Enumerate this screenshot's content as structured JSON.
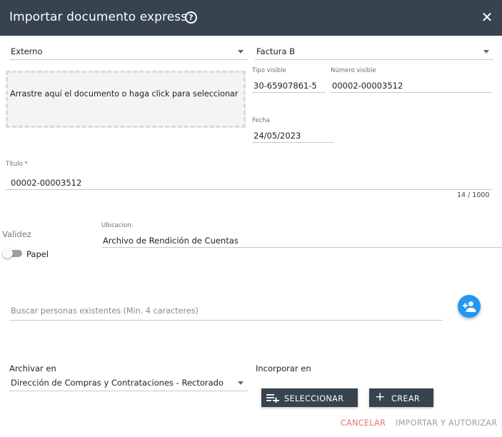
{
  "dialog": {
    "title": "Importar documento express",
    "help_icon": "help-circle-icon",
    "close_icon": "close-icon",
    "help_glyph": "?",
    "close_glyph": "✕"
  },
  "colors": {
    "header": "#37434e",
    "accent": "#2196f3",
    "cancel": "#e57373",
    "disabled": "#9e9e9e"
  },
  "origin_select": {
    "value": "Externo"
  },
  "doc_type_select": {
    "value": "Factura B"
  },
  "dropzone": {
    "text": "Arrastre aquí el documento o haga click para seleccionar"
  },
  "tipo_visible": {
    "label": "Tipo visible",
    "value": "30-65907861-5"
  },
  "numero_visible": {
    "label": "Número visible",
    "value": "00002-00003512"
  },
  "fecha": {
    "label": "Fecha",
    "value": "24/05/2023"
  },
  "titulo": {
    "label": "Título *",
    "value": "00002-00003512",
    "counter": "14 / 1000"
  },
  "validez": {
    "label": "Validez",
    "toggle_label": "Papel",
    "toggle_on": false
  },
  "ubicacion": {
    "label": "Ubicacion:",
    "value": "Archivo de Rendición de Cuentas"
  },
  "search": {
    "placeholder": "Buscar personas existentes (Min. 4 caracteres)",
    "value": "",
    "add_icon": "add-person-icon"
  },
  "archivar": {
    "label": "Archivar en",
    "value": "Dirección de Compras y Contrataciones - Rectorado"
  },
  "incorporar": {
    "label": "Incorporar en",
    "select_label": "SELECCIONAR",
    "create_label": "CREAR",
    "create_glyph": "+"
  },
  "footer": {
    "cancel_label": "CANCELAR",
    "import_label": "IMPORTAR Y AUTORIZAR"
  }
}
